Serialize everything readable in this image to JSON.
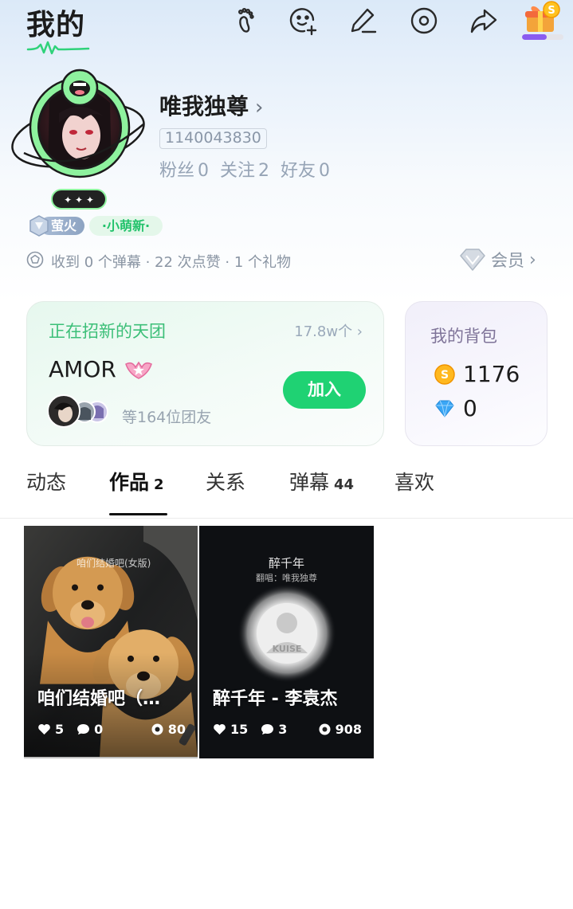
{
  "header": {
    "title": "我的"
  },
  "top_icons": [
    "footprint-icon",
    "add-emoji-icon",
    "edit-pencil-icon",
    "music-disc-icon",
    "share-icon",
    "gift-coin-icon"
  ],
  "gift_progress": 0.6,
  "profile": {
    "username": "唯我独尊",
    "username_chevron": "›",
    "user_id": "1140043830",
    "fans_label": "粉丝",
    "fans": "0",
    "follow_label": "关注",
    "follow": "2",
    "friends_label": "好友",
    "friends": "0"
  },
  "badges": {
    "level": "萤火",
    "newbie": "·小萌新·"
  },
  "stats": {
    "text": "收到 0 个弹幕 · 22 次点赞 · 1 个礼物",
    "vip_label": "会员",
    "vip_chevron": "›"
  },
  "group_card": {
    "heading": "正在招新的天团",
    "count": "17.8w个 ›",
    "name": "AMOR",
    "members_text": "等164位团友",
    "join_label": "加入"
  },
  "backpack": {
    "title": "我的背包",
    "coins": "1176",
    "diamonds": "0"
  },
  "tabs": [
    {
      "label": "动态",
      "count": ""
    },
    {
      "label": "作品",
      "count": "2",
      "active": true
    },
    {
      "label": "关系",
      "count": ""
    },
    {
      "label": "弹幕",
      "count": "44"
    },
    {
      "label": "喜欢",
      "count": ""
    }
  ],
  "works": [
    {
      "title": "咱们结婚吧（…",
      "likes": "5",
      "comments": "0",
      "views": "80",
      "overlay_text": "咱们结婚吧(女版)"
    },
    {
      "title": "醉千年 - 李袁杰",
      "likes": "15",
      "comments": "3",
      "views": "908",
      "overlay_title": "醉千年",
      "overlay_sub": "翻唱：唯我独尊"
    }
  ],
  "colors": {
    "accent_green": "#1fd273",
    "heading_green": "#3cbf78",
    "progress_purple": "#8a5cf0",
    "text_gray": "#8a95a3"
  }
}
